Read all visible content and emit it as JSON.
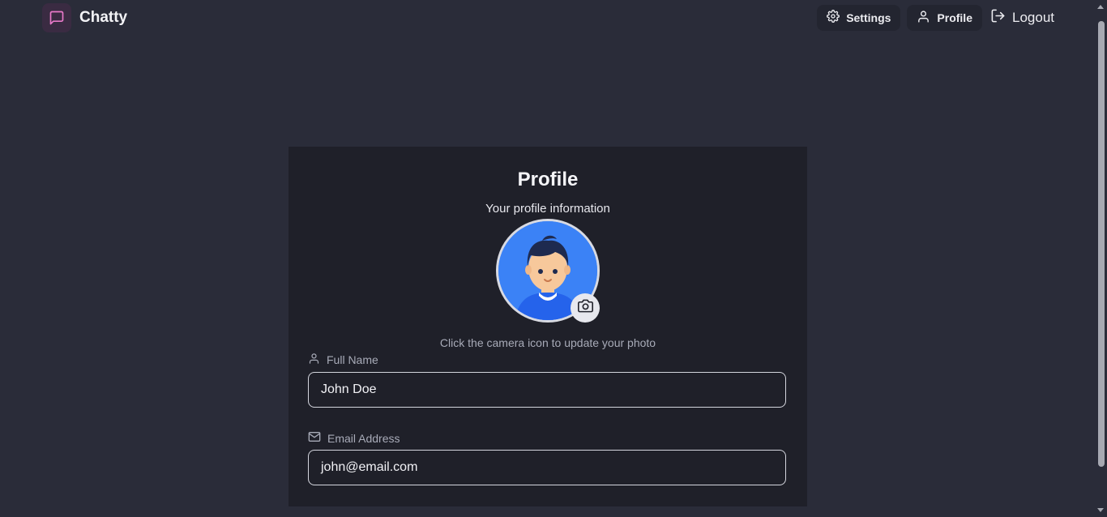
{
  "header": {
    "brand": "Chatty",
    "nav": {
      "settings": "Settings",
      "profile": "Profile",
      "logout": "Logout"
    }
  },
  "profile": {
    "title": "Profile",
    "subtitle": "Your profile information",
    "camera_hint": "Click the camera icon to update your photo",
    "fields": {
      "full_name": {
        "label": "Full Name",
        "value": "John Doe"
      },
      "email": {
        "label": "Email Address",
        "value": "john@email.com"
      }
    }
  },
  "colors": {
    "accent": "#e879c9",
    "background": "#2a2c39",
    "card": "#1f2029",
    "avatar_bg": "#3b82f6"
  },
  "icons": [
    "message-square-icon",
    "gear-icon",
    "user-icon",
    "logout-icon",
    "camera-icon",
    "mail-icon"
  ]
}
